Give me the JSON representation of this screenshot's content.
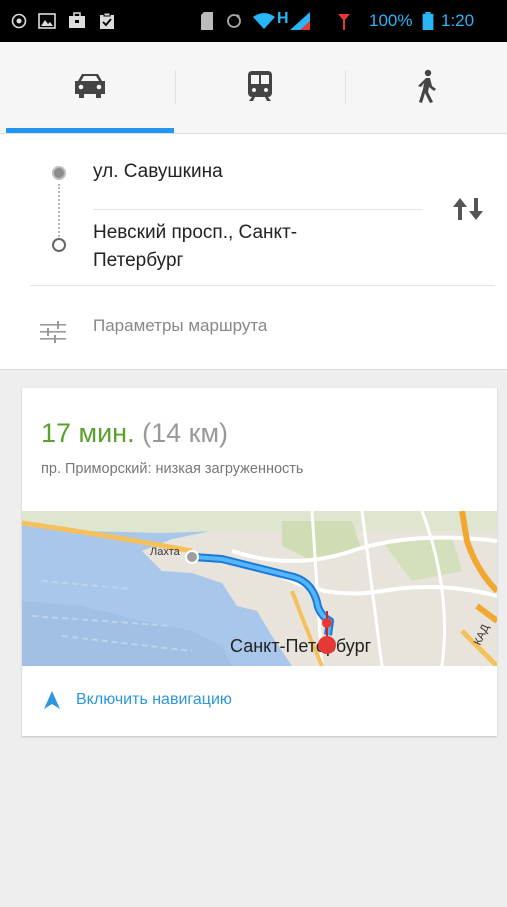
{
  "status_bar": {
    "battery_text": "100%",
    "time": "1:20"
  },
  "tabs": [
    {
      "name": "car",
      "icon": "car-icon",
      "selected": true
    },
    {
      "name": "transit",
      "icon": "bus-icon",
      "selected": false
    },
    {
      "name": "walk",
      "icon": "walk-icon",
      "selected": false
    }
  ],
  "route": {
    "origin": "ул. Савушкина",
    "destination_line1": "Невский просп., Санкт-",
    "destination_line2": "Петербург",
    "options_label": "Параметры маршрута"
  },
  "result": {
    "time_value": "17 мин.",
    "distance": "(14 км)",
    "traffic": "пр. Приморский: низкая загруженность",
    "map_label_start": "Лахта",
    "map_label_city": "Санкт-Петербург",
    "map_label_ring": "КАД",
    "nav_button": "Включить навигацию"
  },
  "colors": {
    "accent": "#2196f3",
    "time_green": "#5aa02c",
    "nav_link": "#2c97de",
    "pin_red": "#e53935"
  }
}
